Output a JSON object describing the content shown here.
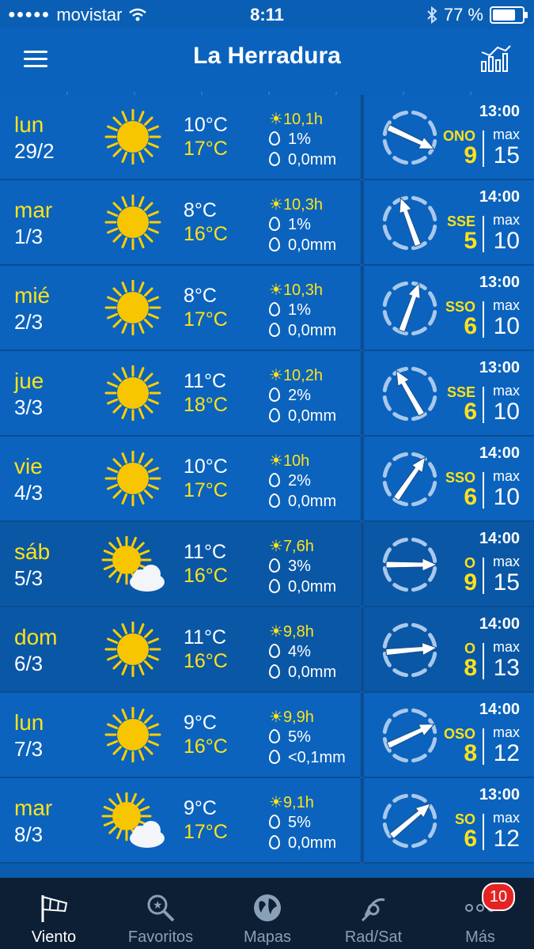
{
  "status": {
    "carrier": "movistar",
    "time": "8:11",
    "battery": "77 %"
  },
  "header": {
    "title": "La Herradura"
  },
  "rows": [
    {
      "day": "lun",
      "date": "29/2",
      "icon": "sun",
      "tmin": "10°C",
      "tmax": "17°C",
      "sun": "10,1h",
      "prob": "1%",
      "precip": "0,0mm",
      "time": "13:00",
      "dir": "ONO",
      "speed": "9",
      "max_label": "max",
      "gust": "15",
      "arrow_deg": 115
    },
    {
      "day": "mar",
      "date": "1/3",
      "icon": "sun",
      "tmin": "8°C",
      "tmax": "16°C",
      "sun": "10,3h",
      "prob": "1%",
      "precip": "0,0mm",
      "time": "14:00",
      "dir": "SSE",
      "speed": "5",
      "max_label": "max",
      "gust": "10",
      "arrow_deg": -20
    },
    {
      "day": "mié",
      "date": "2/3",
      "icon": "sun",
      "tmin": "8°C",
      "tmax": "17°C",
      "sun": "10,3h",
      "prob": "1%",
      "precip": "0,0mm",
      "time": "13:00",
      "dir": "SSO",
      "speed": "6",
      "max_label": "max",
      "gust": "10",
      "arrow_deg": 20
    },
    {
      "day": "jue",
      "date": "3/3",
      "icon": "sun",
      "tmin": "11°C",
      "tmax": "18°C",
      "sun": "10,2h",
      "prob": "2%",
      "precip": "0,0mm",
      "time": "13:00",
      "dir": "SSE",
      "speed": "6",
      "max_label": "max",
      "gust": "10",
      "arrow_deg": -30
    },
    {
      "day": "vie",
      "date": "4/3",
      "icon": "sun",
      "tmin": "10°C",
      "tmax": "17°C",
      "sun": "10h",
      "prob": "2%",
      "precip": "0,0mm",
      "time": "14:00",
      "dir": "SSO",
      "speed": "6",
      "max_label": "max",
      "gust": "10",
      "arrow_deg": 35
    },
    {
      "day": "sáb",
      "date": "5/3",
      "icon": "sun-cloud",
      "tmin": "11°C",
      "tmax": "16°C",
      "sun": "7,6h",
      "prob": "3%",
      "precip": "0,0mm",
      "time": "14:00",
      "dir": "O",
      "speed": "9",
      "max_label": "max",
      "gust": "15",
      "arrow_deg": 90
    },
    {
      "day": "dom",
      "date": "6/3",
      "icon": "sun",
      "tmin": "11°C",
      "tmax": "16°C",
      "sun": "9,8h",
      "prob": "4%",
      "precip": "0,0mm",
      "time": "14:00",
      "dir": "O",
      "speed": "8",
      "max_label": "max",
      "gust": "13",
      "arrow_deg": 85
    },
    {
      "day": "lun",
      "date": "7/3",
      "icon": "sun",
      "tmin": "9°C",
      "tmax": "16°C",
      "sun": "9,9h",
      "prob": "5%",
      "precip": "<0,1mm",
      "time": "14:00",
      "dir": "OSO",
      "speed": "8",
      "max_label": "max",
      "gust": "12",
      "arrow_deg": 65
    },
    {
      "day": "mar",
      "date": "8/3",
      "icon": "sun-cloud",
      "tmin": "9°C",
      "tmax": "17°C",
      "sun": "9,1h",
      "prob": "5%",
      "precip": "0,0mm",
      "time": "13:00",
      "dir": "SO",
      "speed": "6",
      "max_label": "max",
      "gust": "12",
      "arrow_deg": 50
    }
  ],
  "tabs": [
    {
      "label": "Viento",
      "icon": "windsock-icon",
      "active": true
    },
    {
      "label": "Favoritos",
      "icon": "search-star-icon",
      "active": false
    },
    {
      "label": "Mapas",
      "icon": "globe-icon",
      "active": false
    },
    {
      "label": "Rad/Sat",
      "icon": "satellite-icon",
      "active": false
    },
    {
      "label": "Más",
      "icon": "more-icon",
      "active": false,
      "badge": "10"
    }
  ]
}
